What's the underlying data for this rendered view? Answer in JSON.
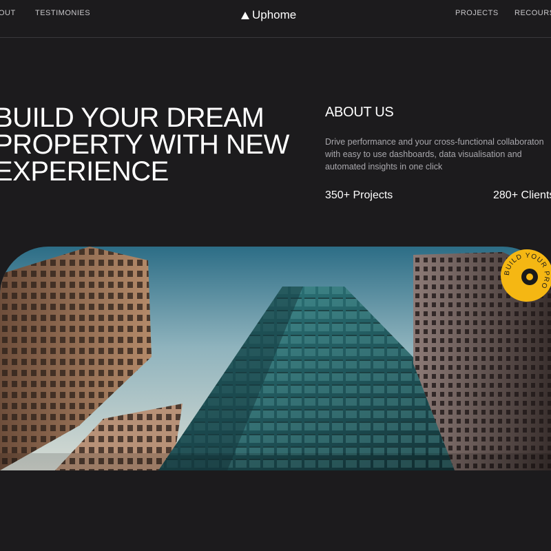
{
  "nav": {
    "left_items": [
      "OUT",
      "TESTIMONIES"
    ],
    "logo": "Uphome",
    "right_items": [
      "PROJECTS",
      "RECOURS"
    ]
  },
  "hero": {
    "title": "BUILD YOUR DREAM\nPROPERTY WITH NEW\nEXPERIENCE"
  },
  "about": {
    "title": "ABOUT US",
    "lines": [
      "Drive performance and your cross-functional collaboraton",
      "with easy to use dashboards, data visualisation and",
      "automated insights in one click"
    ],
    "stats": [
      "350+ Projects",
      "280+ Clients"
    ]
  },
  "badge": {
    "text": "BUILD YOUR PRO"
  },
  "colors": {
    "background": "#1c1b1d",
    "badge": "#f5b713"
  }
}
